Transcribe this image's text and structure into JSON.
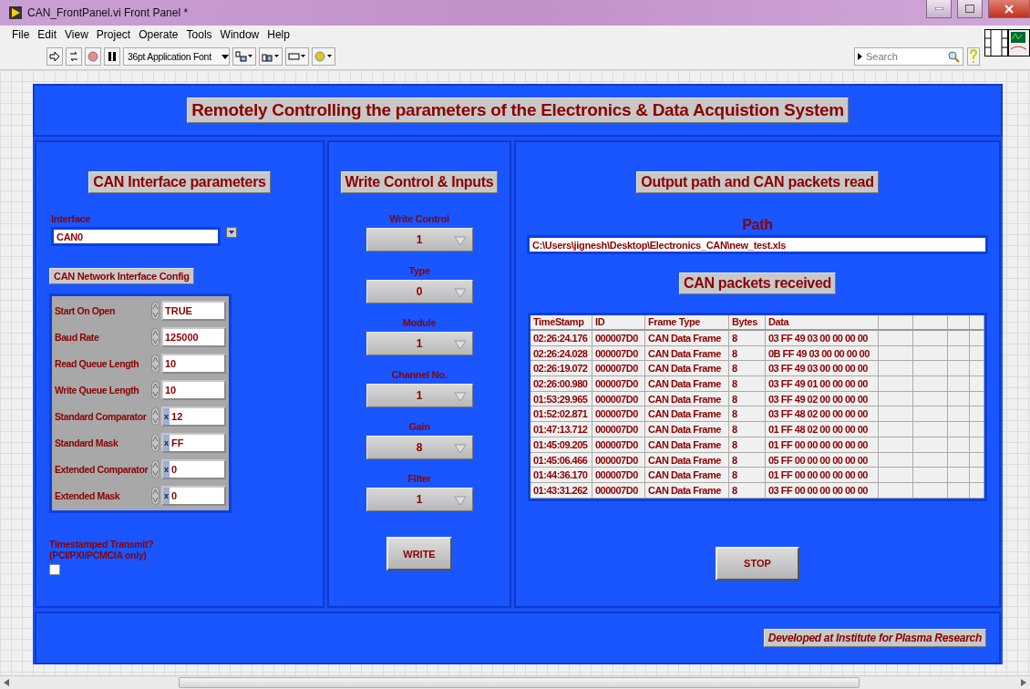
{
  "window": {
    "title": "CAN_FrontPanel.vi Front Panel *"
  },
  "menu": [
    "File",
    "Edit",
    "View",
    "Project",
    "Operate",
    "Tools",
    "Window",
    "Help"
  ],
  "toolbar": {
    "font_selector": "36pt Application Font",
    "search": {
      "placeholder": "Search"
    }
  },
  "header": {
    "title": "Remotely Controlling the parameters of the Electronics & Data Acquistion System"
  },
  "interface_panel": {
    "title": "CAN Interface parameters",
    "interface": {
      "label": "Interface",
      "value": "CAN0"
    },
    "config": {
      "title": "CAN Network Interface Config",
      "fields": [
        {
          "label": "Start On Open",
          "value": "TRUE"
        },
        {
          "label": "Baud Rate",
          "value": "125000"
        },
        {
          "label": "Read Queue Length",
          "value": "10"
        },
        {
          "label": "Write Queue Length",
          "value": "10"
        },
        {
          "label": "Standard Comparator",
          "value": "12",
          "radix": "x"
        },
        {
          "label": "Standard Mask",
          "value": "FF",
          "radix": "x"
        },
        {
          "label": "Extended Comparator",
          "value": "0",
          "radix": "x"
        },
        {
          "label": "Extended Mask",
          "value": "0",
          "radix": "x"
        }
      ]
    },
    "timestamped": {
      "label": "Timestamped Transmit?\n(PCI/PXI/PCMCIA only)",
      "checked": false
    }
  },
  "write_panel": {
    "title": "Write Control & Inputs",
    "controls": [
      {
        "label": "Write Control",
        "value": "1"
      },
      {
        "label": "Type",
        "value": "0"
      },
      {
        "label": "Module",
        "value": "1"
      },
      {
        "label": "Channel No.",
        "value": "1"
      },
      {
        "label": "Gain",
        "value": "8"
      },
      {
        "label": "Filter",
        "value": "1"
      }
    ],
    "button": "WRITE"
  },
  "output_panel": {
    "title": "Output path and CAN packets read",
    "path": {
      "label": "Path",
      "value": "C:\\Users\\jignesh\\Desktop\\Electronics_CAN\\new_test.xls"
    },
    "packets": {
      "title": "CAN packets received",
      "table": {
        "columns": [
          "TimeStamp",
          "ID",
          "Frame Type",
          "Bytes",
          "Data"
        ],
        "rows": [
          [
            "02:26:24.176",
            "000007D0",
            "CAN Data Frame",
            "8",
            "03 FF 49 03 00 00 00 00"
          ],
          [
            "02:26:24.028",
            "000007D0",
            "CAN Data Frame",
            "8",
            "0B FF 49 03 00 00 00 00"
          ],
          [
            "02:26:19.072",
            "000007D0",
            "CAN Data Frame",
            "8",
            "03 FF 49 03 00 00 00 00"
          ],
          [
            "02:26:00.980",
            "000007D0",
            "CAN Data Frame",
            "8",
            "03 FF 49 01 00 00 00 00"
          ],
          [
            "01:53:29.965",
            "000007D0",
            "CAN Data Frame",
            "8",
            "03 FF 49 02 00 00 00 00"
          ],
          [
            "01:52:02.871",
            "000007D0",
            "CAN Data Frame",
            "8",
            "03 FF 48 02 00 00 00 00"
          ],
          [
            "01:47:13.712",
            "000007D0",
            "CAN Data Frame",
            "8",
            "01 FF 48 02 00 00 00 00"
          ],
          [
            "01:45:09.205",
            "000007D0",
            "CAN Data Frame",
            "8",
            "01 FF 00 00 00 00 00 00"
          ],
          [
            "01:45:06.466",
            "000007D0",
            "CAN Data Frame",
            "8",
            "05 FF 00 00 00 00 00 00"
          ],
          [
            "01:44:36.170",
            "000007D0",
            "CAN Data Frame",
            "8",
            "01 FF 00 00 00 00 00 00"
          ],
          [
            "01:43:31.262",
            "000007D0",
            "CAN Data Frame",
            "8",
            "03 FF 00 00 00 00 00 00"
          ]
        ]
      }
    },
    "button": "STOP"
  },
  "footer": {
    "credit": "Developed at Institute for Plasma Research"
  }
}
